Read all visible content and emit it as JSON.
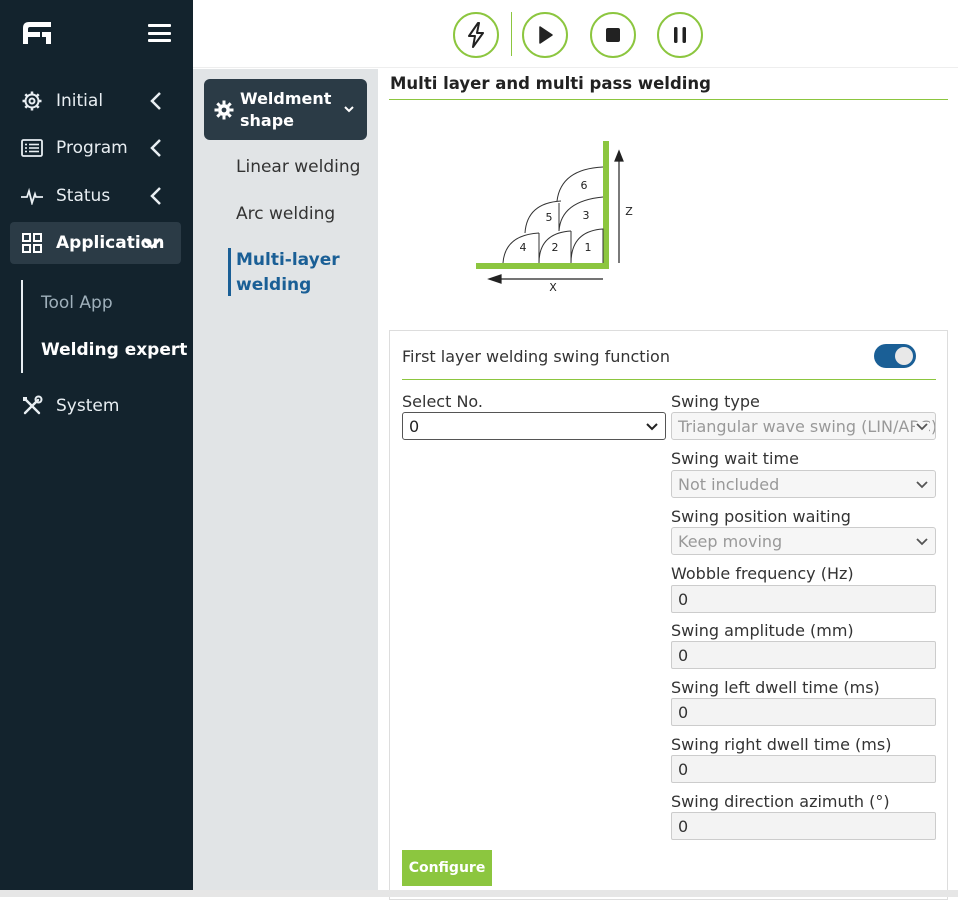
{
  "sidebar": {
    "items": [
      {
        "label": "Initial"
      },
      {
        "label": "Program"
      },
      {
        "label": "Status"
      },
      {
        "label": "Application"
      },
      {
        "label": "System"
      }
    ],
    "sub_items": [
      {
        "label": "Tool App"
      },
      {
        "label": "Welding expert"
      }
    ]
  },
  "secondary_menu": {
    "header": "Weldment shape",
    "items": [
      {
        "label": "Linear welding"
      },
      {
        "label": "Arc welding"
      },
      {
        "label": "Multi-layer welding"
      }
    ]
  },
  "main": {
    "title": "Multi layer and multi pass welding",
    "diagram": {
      "passes": [
        "1",
        "2",
        "3",
        "4",
        "5",
        "6"
      ],
      "z_label": "Z",
      "x_label": "X"
    },
    "panel": {
      "swing_function_label": "First layer welding swing function",
      "swing_enabled": true,
      "select_no": {
        "label": "Select No.",
        "value": "0"
      },
      "swing_type": {
        "label": "Swing type",
        "value": "Triangular wave swing (LIN/ARC)"
      },
      "swing_wait_time": {
        "label": "Swing wait time",
        "value": "Not included"
      },
      "swing_position_waiting": {
        "label": "Swing position waiting",
        "value": "Keep moving"
      },
      "wobble_frequency": {
        "label": "Wobble frequency (Hz)",
        "value": "0"
      },
      "swing_amplitude": {
        "label": "Swing amplitude (mm)",
        "value": "0"
      },
      "swing_left_dwell": {
        "label": "Swing left dwell time (ms)",
        "value": "0"
      },
      "swing_right_dwell": {
        "label": "Swing right dwell time (ms)",
        "value": "0"
      },
      "swing_azimuth": {
        "label": "Swing direction azimuth (°)",
        "value": "0"
      },
      "configure_label": "Configure"
    }
  },
  "colors": {
    "accent_green": "#8cc63f",
    "nav_bg": "#13232d",
    "active_blue": "#1a5f96"
  }
}
